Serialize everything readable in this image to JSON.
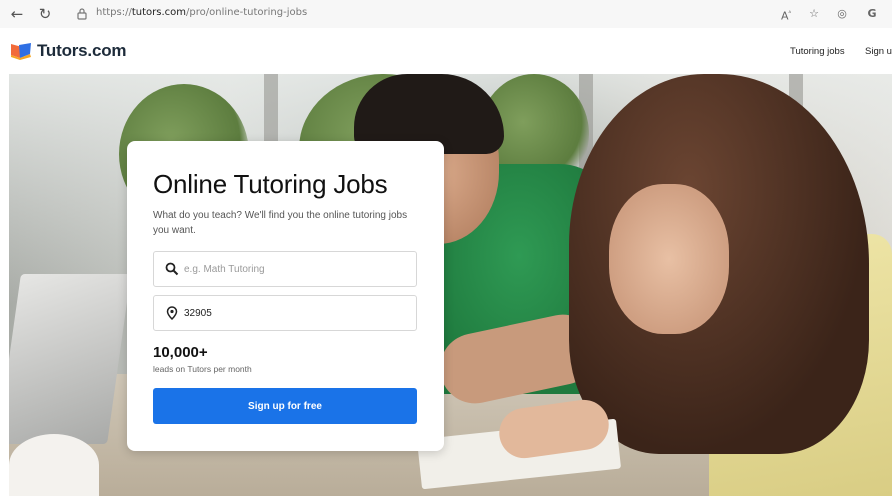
{
  "browser": {
    "back_icon": "back-arrow-icon",
    "refresh_icon": "refresh-icon",
    "url_domain_prefix": "https://",
    "url_domain": "tutors.com",
    "url_path": "/pro/online-tutoring-jobs",
    "toolbar_icons": [
      "read-aloud-icon",
      "favorites-icon",
      "extensions-icon",
      "profile-icon"
    ]
  },
  "header": {
    "logo_text": "Tutors.com",
    "nav": [
      {
        "label": "Tutoring jobs"
      },
      {
        "label": "Sign u"
      }
    ]
  },
  "card": {
    "title": "Online Tutoring Jobs",
    "subtitle": "What do you teach? We'll find you the online tutoring jobs you want.",
    "search_placeholder": "e.g. Math Tutoring",
    "search_value": "",
    "zip_value": "32905",
    "stat_value": "10,000+",
    "stat_caption": "leads on Tutors per month",
    "cta_label": "Sign up for free"
  },
  "colors": {
    "accent": "#1a73e8",
    "logo_orange": "#f26b3a",
    "logo_blue": "#2f6fe4",
    "text_dark": "#111111"
  }
}
